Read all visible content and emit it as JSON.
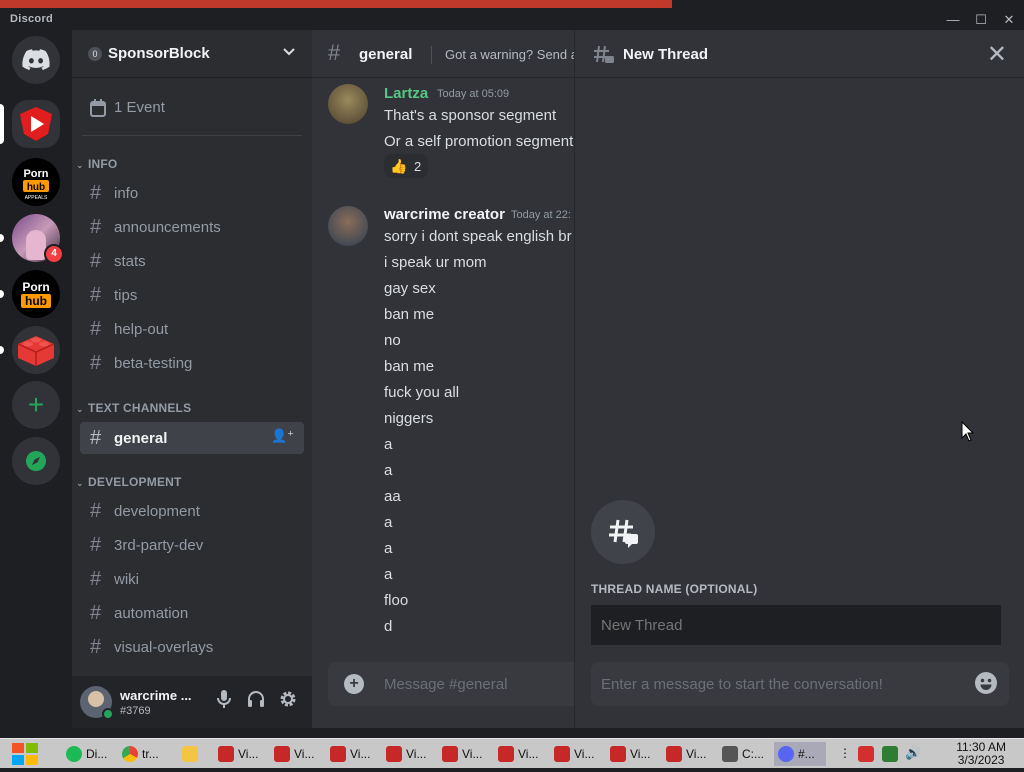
{
  "window": {
    "app_name": "Discord",
    "controls": {
      "minimize": "—",
      "maximize": "☐",
      "close": "✕"
    }
  },
  "servers": [
    {
      "name": "Direct Messages",
      "icon": "discord-icon",
      "color": "#313338"
    },
    {
      "name": "SponsorBlock",
      "icon": "sponsorblock-icon",
      "color": "#e21d1d",
      "selected": true
    },
    {
      "name": "Porn hub appeals",
      "icon": "server-icon",
      "color": "#000000",
      "text": "Porn hub APPEALS"
    },
    {
      "name": "Server with badge",
      "icon": "avatar-icon",
      "badge": "4"
    },
    {
      "name": "Porn hub",
      "icon": "server-icon",
      "color": "#000000",
      "text": "Porn hub"
    },
    {
      "name": "Lego server",
      "icon": "lego-icon",
      "color": "#e53935"
    },
    {
      "name": "Add a Server",
      "icon": "plus-icon"
    },
    {
      "name": "Explore",
      "icon": "compass-icon"
    }
  ],
  "sidebar": {
    "guild_name": "SponsorBlock",
    "event_label": "1 Event",
    "categories": [
      {
        "name": "INFO",
        "channels": [
          "info",
          "announcements",
          "stats",
          "tips",
          "help-out",
          "beta-testing"
        ]
      },
      {
        "name": "TEXT CHANNELS",
        "channels": [
          "general"
        ]
      },
      {
        "name": "DEVELOPMENT",
        "channels": [
          "development",
          "3rd-party-dev",
          "wiki",
          "automation",
          "visual-overlays"
        ]
      }
    ],
    "active_channel": "general"
  },
  "user_panel": {
    "username": "warcrime ...",
    "tag": "#3769"
  },
  "chat": {
    "channel": "general",
    "topic": "Got a warning? Send a",
    "messages": [
      {
        "author": "Lartza",
        "author_color": "#57c785",
        "time": "Today at 05:09",
        "lines": [
          "That's a sponsor segment",
          "Or a self promotion segment"
        ],
        "reaction": {
          "emoji": "👍",
          "count": "2"
        }
      },
      {
        "author": "warcrime creator",
        "author_color": "#f2f3f5",
        "time": "Today at 22:",
        "lines": [
          "sorry i dont speak english br",
          "i speak ur mom",
          "gay sex",
          "ban me",
          "no",
          "ban me",
          "fuck you all",
          "niggers",
          "a",
          "a",
          "aa",
          "a",
          "a",
          "a",
          "floo",
          "d"
        ]
      }
    ],
    "composer_placeholder": "Message #general"
  },
  "thread": {
    "title": "New Thread",
    "name_label": "THREAD NAME (OPTIONAL)",
    "name_placeholder": "New Thread",
    "message_placeholder": "Enter a message to start the conversation!"
  },
  "taskbar": {
    "items": [
      {
        "label": "Di...",
        "color": "#1db954"
      },
      {
        "label": "tr...",
        "color": "#4285f4"
      },
      {
        "label": "",
        "color": "#f4c542"
      },
      {
        "label": "Vi...",
        "color": "#c62828"
      },
      {
        "label": "Vi...",
        "color": "#c62828"
      },
      {
        "label": "Vi...",
        "color": "#c62828"
      },
      {
        "label": "Vi...",
        "color": "#c62828"
      },
      {
        "label": "Vi...",
        "color": "#c62828"
      },
      {
        "label": "Vi...",
        "color": "#c62828"
      },
      {
        "label": "Vi...",
        "color": "#c62828"
      },
      {
        "label": "Vi...",
        "color": "#c62828"
      },
      {
        "label": "Vi...",
        "color": "#c62828"
      },
      {
        "label": "C:...",
        "color": "#555555"
      },
      {
        "label": "#...",
        "color": "#5865f2"
      }
    ],
    "clock_time": "11:30 AM",
    "clock_date": "3/3/2023"
  }
}
